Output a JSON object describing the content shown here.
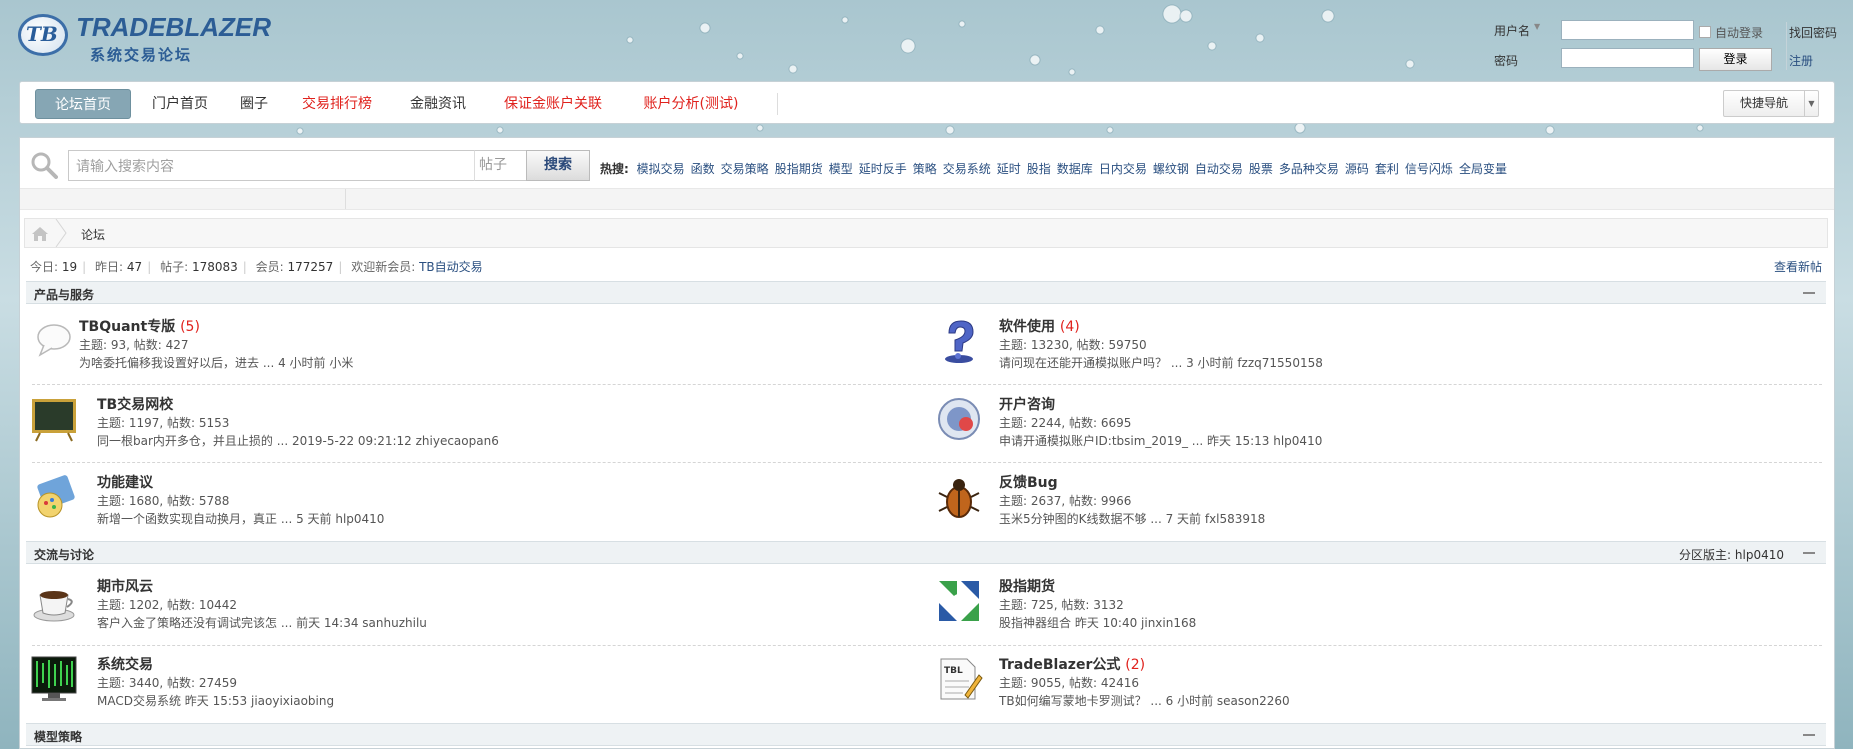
{
  "logo": {
    "title": "TRADEBLAZER",
    "subtitle": "系统交易论坛",
    "mark": "TB"
  },
  "login": {
    "username_label": "用户名",
    "password_label": "密码",
    "username_value": "",
    "password_value": "",
    "auto_login": "自动登录",
    "login_button": "登录",
    "forgot_password": "找回密码",
    "register": "注册"
  },
  "nav": {
    "items": [
      {
        "label": "论坛首页"
      },
      {
        "label": "门户首页"
      },
      {
        "label": "圈子"
      },
      {
        "label": "交易排行榜"
      },
      {
        "label": "金融资讯"
      },
      {
        "label": "保证金账户关联"
      },
      {
        "label": "账户分析(测试)"
      }
    ],
    "quick_nav": "快捷导航"
  },
  "search": {
    "placeholder": "请输入搜索内容",
    "type": "帖子",
    "button": "搜索",
    "hot_label": "热搜:",
    "hot_terms": [
      "模拟交易",
      "函数",
      "交易策略",
      "股指期货",
      "模型",
      "延时反手",
      "策略",
      "交易系统",
      "延时",
      "股指",
      "数据库",
      "日内交易",
      "螺纹钢",
      "自动交易",
      "股票",
      "多品种交易",
      "源码",
      "套利",
      "信号闪烁",
      "全局变量"
    ]
  },
  "breadcrumb": {
    "current": "论坛"
  },
  "stats": {
    "today_label": "今日:",
    "today": "19",
    "yesterday_label": "昨日:",
    "yesterday": "47",
    "posts_label": "帖子:",
    "posts": "178083",
    "members_label": "会员:",
    "members": "177257",
    "welcome_label": "欢迎新会员:",
    "new_member": "TB自动交易",
    "new_posts": "查看新帖"
  },
  "categories": [
    {
      "title": "产品与服务",
      "moderator": "",
      "forums": [
        {
          "name": "TBQuant专版",
          "count": "(5)",
          "meta": "主题: 93, 帖数: 427",
          "last": "为啥委托偏移我设置好以后，进去 ... 4 小时前 小米",
          "icon": "chat-bubble-icon"
        },
        {
          "name": "软件使用",
          "count": "(4)",
          "meta": "主题: 13230, 帖数: 59750",
          "last": "请问现在还能开通模拟账户吗？ ... 3 小时前 fzzq71550158",
          "icon": "question-mark-icon"
        },
        {
          "name": "TB交易网校",
          "count": "",
          "meta": "主题: 1197, 帖数: 5153",
          "last": "同一根bar内开多仓，并且止损的 ... 2019-5-22 09:21:12 zhiyecaopan6",
          "icon": "blackboard-icon"
        },
        {
          "name": "开户咨询",
          "count": "",
          "meta": "主题: 2244, 帖数: 6695",
          "last": "申请开通模拟账户ID:tbsim_2019_ ... 昨天 15:13 hlp0410",
          "icon": "settings-globe-icon"
        },
        {
          "name": "功能建议",
          "count": "",
          "meta": "主题: 1680, 帖数: 5788",
          "last": "新增一个函数实现自动换月，真正 ... 5 天前 hlp0410",
          "icon": "paint-palette-icon"
        },
        {
          "name": "反馈Bug",
          "count": "",
          "meta": "主题: 2637, 帖数: 9966",
          "last": "玉米5分钟图的K线数据不够 ... 7 天前 fxl583918",
          "icon": "bug-icon"
        }
      ]
    },
    {
      "title": "交流与讨论",
      "moderator": "分区版主: hlp0410",
      "forums": [
        {
          "name": "期市风云",
          "count": "",
          "meta": "主题: 1202, 帖数: 10442",
          "last": "客户入金了策略还没有调试完该怎 ... 前天 14:34 sanhuzhilu",
          "icon": "coffee-cup-icon"
        },
        {
          "name": "股指期货",
          "count": "",
          "meta": "主题: 725, 帖数: 3132",
          "last": "股指神器组合 昨天 10:40 jinxin168",
          "icon": "green-blue-arrows-icon"
        },
        {
          "name": "系统交易",
          "count": "",
          "meta": "主题: 3440, 帖数: 27459",
          "last": "MACD交易系统 昨天 15:53 jiaoyixiaobing",
          "icon": "matrix-monitor-icon"
        },
        {
          "name": "TradeBlazer公式",
          "count": "(2)",
          "meta": "主题: 9055, 帖数: 42416",
          "last": "TB如何编写蒙地卡罗测试？ ... 6 小时前 season2260",
          "icon": "tbl-document-icon"
        }
      ]
    },
    {
      "title": "模型策略",
      "moderator": "",
      "forums": []
    }
  ]
}
